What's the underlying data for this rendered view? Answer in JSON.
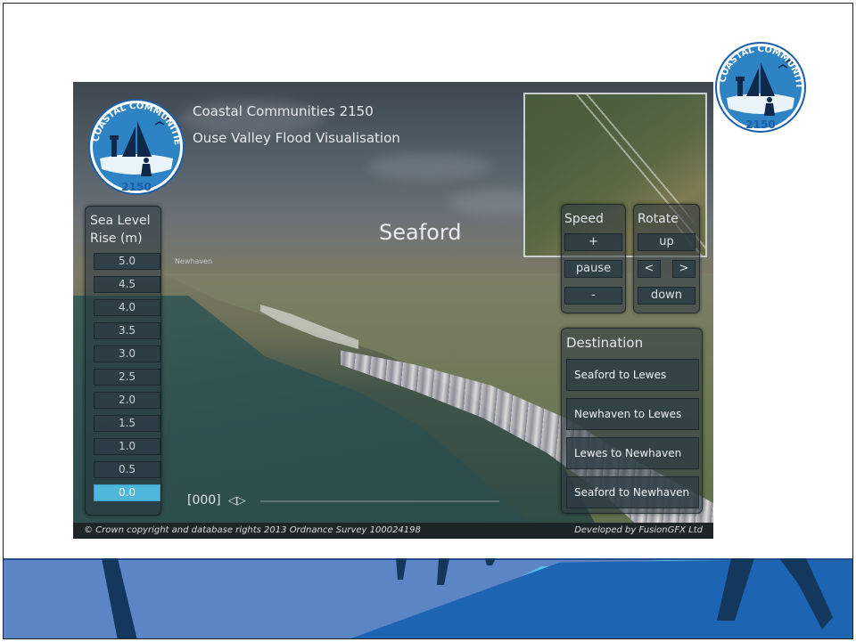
{
  "app": {
    "title_line1": "Coastal Communities 2150",
    "title_line2": "Ouse Valley Flood Visualisation",
    "location": "Seaford",
    "map_label": "Newhaven",
    "logo_text_top": "COASTAL COMMUNITIES",
    "logo_text_bottom": "2150"
  },
  "sea_level": {
    "title_line1": "Sea Level",
    "title_line2": "Rise (m)",
    "options": [
      "5.0",
      "4.5",
      "4.0",
      "3.5",
      "3.0",
      "2.5",
      "2.0",
      "1.5",
      "1.0",
      "0.5",
      "0.0"
    ],
    "selected": "0.0"
  },
  "speed": {
    "title": "Speed",
    "increase": "+",
    "pause": "pause",
    "decrease": "-"
  },
  "rotate": {
    "title": "Rotate",
    "up": "up",
    "left": "<",
    "right": ">",
    "down": "down"
  },
  "destination": {
    "title": "Destination",
    "options": [
      "Seaford to Lewes",
      "Newhaven to Lewes",
      "Lewes to Newhaven",
      "Seaford to Newhaven"
    ]
  },
  "timeline": {
    "frame": "[000]",
    "arrows": "◁▷"
  },
  "footer": {
    "copyright": "© Crown copyright and database rights 2013 Ordnance Survey 100024198",
    "credit": "Developed by FusionGFX Ltd"
  },
  "colors": {
    "accent": "#4fb6db",
    "logo_blue": "#2d83c4",
    "banner_dark": "#1d64b2",
    "banner_light": "#58c1ea"
  }
}
